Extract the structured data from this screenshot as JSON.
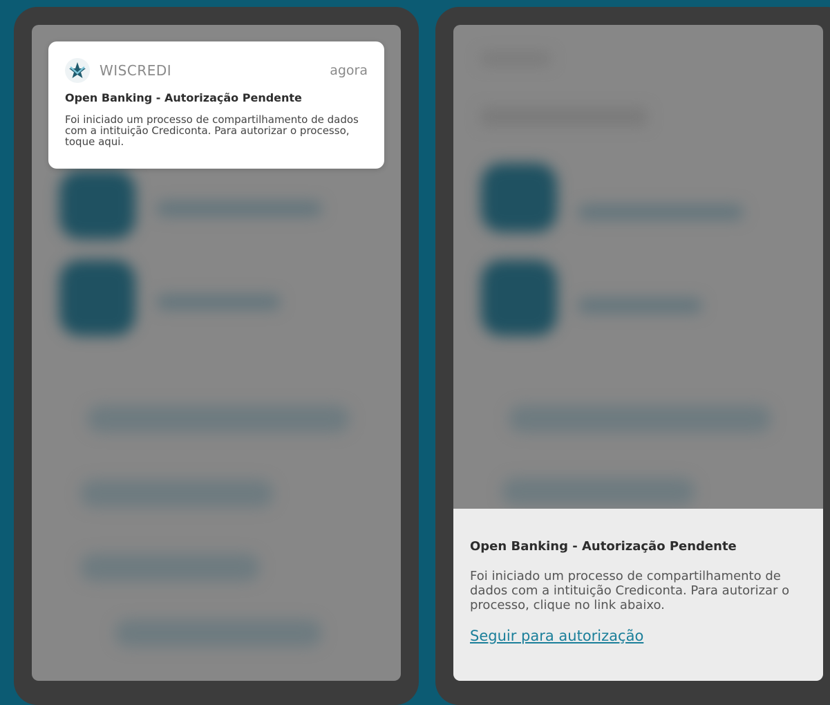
{
  "notification": {
    "app_name": "WISCREDI",
    "time": "agora",
    "title": "Open Banking - Autorização Pendente",
    "body": "Foi iniciado um processo de compartilhamento de dados com a intituição Crediconta. Para autorizar o processo, toque aqui.",
    "icon": "wiscredi-logo-icon"
  },
  "sheet": {
    "title": "Open Banking - Autorização Pendente",
    "body": "Foi iniciado um processo de compartilhamento de dados com a intituição Crediconta. Para autorizar o processo, clique no link abaixo.",
    "link": "Seguir para autorização"
  },
  "colors": {
    "background": "#0c5b73",
    "phone_frame": "#3c3c3c",
    "blurred_screen": "#878787",
    "link": "#1b7f9a",
    "logo_star": "#1f5a6d"
  }
}
